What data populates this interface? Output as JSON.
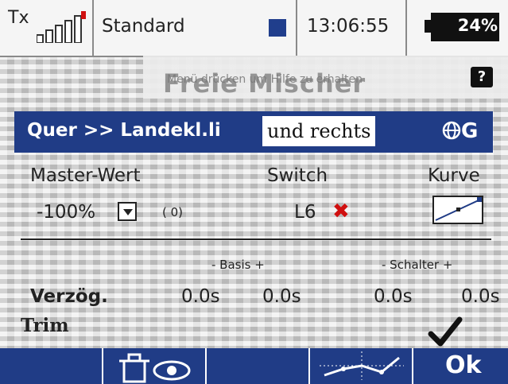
{
  "status": {
    "tx_label": "Tx",
    "model": "Standard",
    "time": "13:06:55",
    "battery": "24%"
  },
  "help": {
    "text": "Menü drücken um Hilfe zu erhalten",
    "icon": "help-question-icon"
  },
  "screen_title": "Freie Mischer",
  "mixer": {
    "name": "Quer >> Landekl.li",
    "note": "und rechts",
    "global_icon": "globe-icon",
    "global_letter": "G"
  },
  "master": {
    "label": "Master-Wert",
    "value": "-100%",
    "paren": "( 0)"
  },
  "switch": {
    "label": "Switch",
    "value": "L6"
  },
  "curve": {
    "label": "Kurve"
  },
  "delay": {
    "basis_label": "- Basis +",
    "schalter_label": "- Schalter +",
    "label": "Verzög.",
    "values": [
      "0.0s",
      "0.0s",
      "0.0s",
      "0.0s"
    ]
  },
  "trim": {
    "label": "Trim",
    "state": "checked"
  },
  "bottom": {
    "ok": "Ok"
  },
  "colors": {
    "accent": "#203c86",
    "switch_off": "#d01010"
  }
}
